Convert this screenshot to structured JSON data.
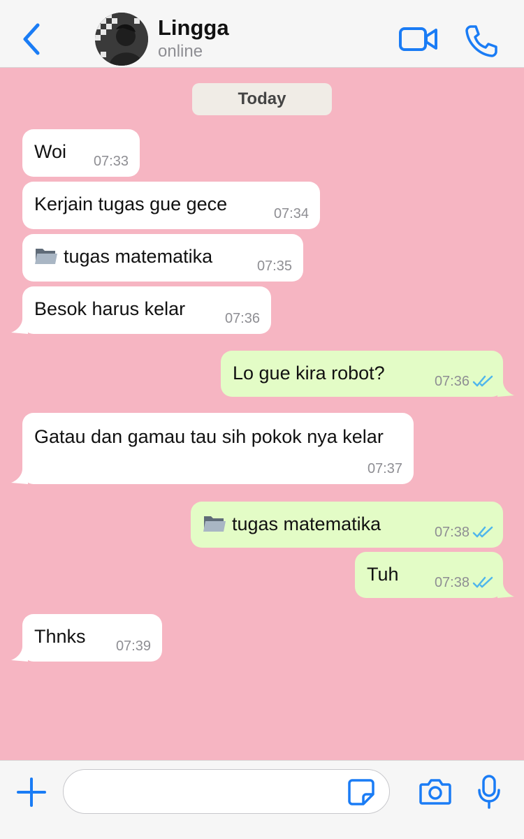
{
  "header": {
    "contact_name": "Lingga",
    "status": "online"
  },
  "chat": {
    "date_label": "Today",
    "messages": [
      {
        "direction": "in",
        "text": "Woi",
        "time": "07:33"
      },
      {
        "direction": "in",
        "text": "Kerjain tugas gue gece",
        "time": "07:34"
      },
      {
        "direction": "in",
        "text": "tugas matematika",
        "time": "07:35",
        "attachment": "folder-icon"
      },
      {
        "direction": "in",
        "text": "Besok harus kelar",
        "time": "07:36"
      },
      {
        "direction": "out",
        "text": "Lo gue kira robot?",
        "time": "07:36",
        "status": "read"
      },
      {
        "direction": "in",
        "text": "Gatau dan gamau tau sih pokok nya kelar",
        "time": "07:37"
      },
      {
        "direction": "out",
        "text": "tugas matematika",
        "time": "07:38",
        "attachment": "folder-icon",
        "status": "read"
      },
      {
        "direction": "out",
        "text": "Tuh",
        "time": "07:38",
        "status": "read"
      },
      {
        "direction": "in",
        "text": "Thnks",
        "time": "07:39"
      }
    ]
  },
  "composer": {
    "placeholder": "",
    "value": ""
  },
  "colors": {
    "accent": "#1a7cf5",
    "chat_background": "#f6b5c2",
    "incoming_bubble": "#ffffff",
    "outgoing_bubble": "#e3fcc6",
    "read_ticks": "#4fb6ec"
  }
}
